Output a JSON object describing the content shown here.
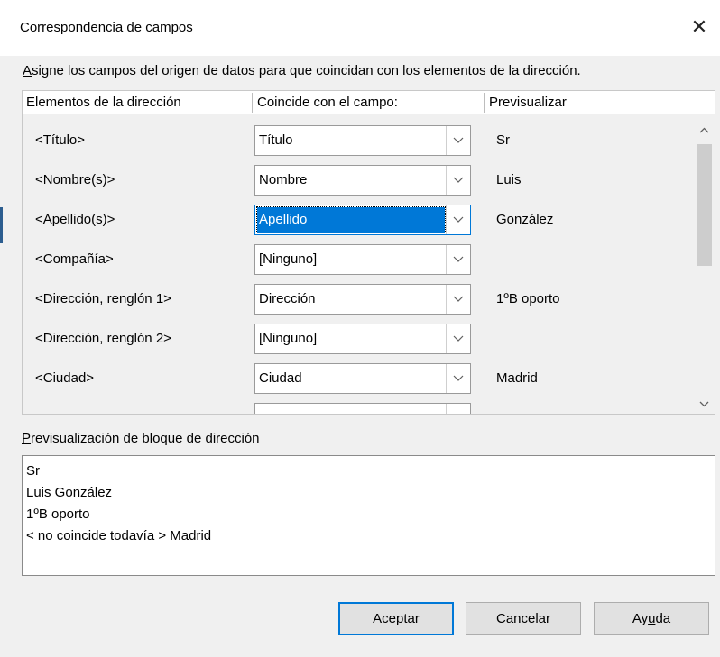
{
  "dialog": {
    "title": "Correspondencia de campos",
    "close_glyph": "✕",
    "instruction_underlined": "A",
    "instruction_rest": "signe los campos del origen de datos para que coincidan con los elementos de la dirección."
  },
  "table": {
    "headers": [
      "Elementos de la dirección",
      "Coincide con el campo:",
      "Previsualizar"
    ],
    "rows": [
      {
        "element": "<Título>",
        "field": "Título",
        "preview": "Sr"
      },
      {
        "element": "<Nombre(s)>",
        "field": "Nombre",
        "preview": "Luis"
      },
      {
        "element": "<Apellido(s)>",
        "field": "Apellido",
        "preview": "González"
      },
      {
        "element": "<Compañía>",
        "field": "[Ninguno]",
        "preview": ""
      },
      {
        "element": "<Dirección, renglón 1>",
        "field": "Dirección",
        "preview": "1ºB oporto"
      },
      {
        "element": "<Dirección, renglón 2>",
        "field": "[Ninguno]",
        "preview": ""
      },
      {
        "element": "<Ciudad>",
        "field": "Ciudad",
        "preview": "Madrid"
      }
    ],
    "selected_row": 2
  },
  "preview_block": {
    "label_underlined": "P",
    "label_rest": "revisualización de bloque de dirección",
    "lines": [
      "Sr",
      "Luis González",
      "1ºB oporto",
      "< no coincide todavía > Madrid"
    ]
  },
  "buttons": {
    "ok": "Aceptar",
    "cancel": "Cancelar",
    "help_pre": "Ay",
    "help_underlined": "u",
    "help_post": "da"
  },
  "icons": {
    "close": "close-icon",
    "dropdown": "chevron-down-icon",
    "scroll_up": "chevron-up-icon",
    "scroll_down": "chevron-down-icon"
  },
  "colors": {
    "accent": "#0078d7",
    "dialog_bg": "#f0f0f0",
    "button_bg": "#e1e1e1"
  }
}
